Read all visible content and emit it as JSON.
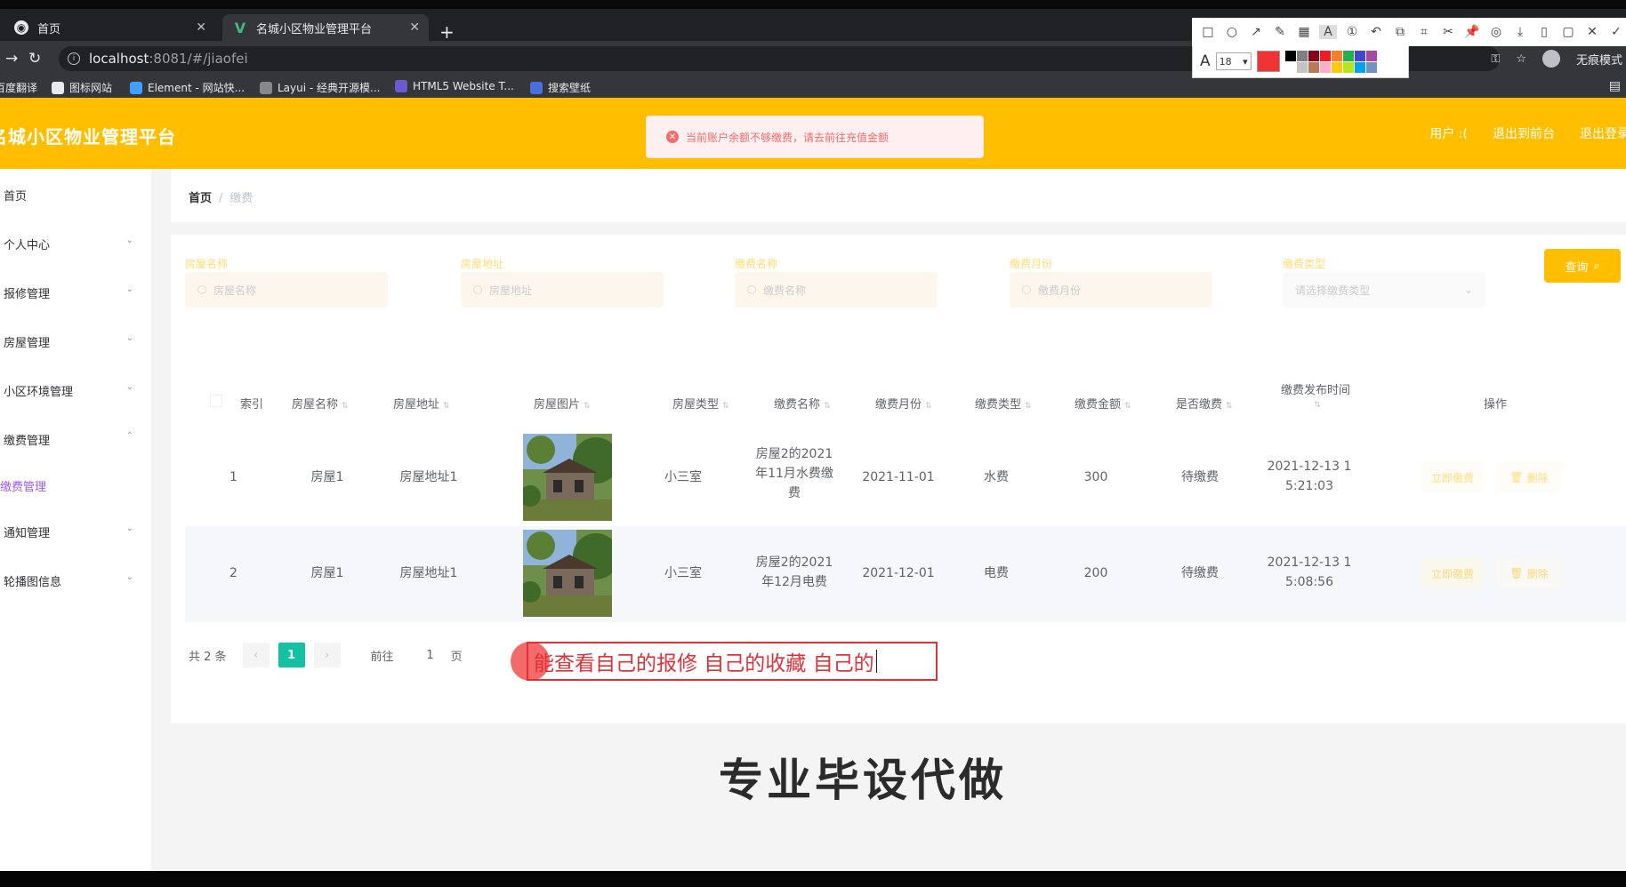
{
  "browser": {
    "tabs": [
      {
        "title": "首页",
        "favicon": "globe-icon"
      },
      {
        "title": "名城小区物业管理平台",
        "favicon": "vue-icon"
      }
    ],
    "url_host": "localhost",
    "url_port": ":8081",
    "url_path": "/#/jiaofei",
    "incognito_label": "无痕模式",
    "bookmarks": [
      "百度翻译",
      "图标网站",
      "Element - 网站快...",
      "Layui - 经典开源模...",
      "HTML5 Website T...",
      "搜索壁纸"
    ]
  },
  "snip_toolbar": {
    "font_size": "18",
    "current_color": "#f03434",
    "palette": [
      "#000000",
      "#7f7f7f",
      "#880015",
      "#ed1c24",
      "#ff7f27",
      "#22b14c",
      "#3f48cc",
      "#a349a4",
      "#ffffff",
      "#c3c3c3",
      "#b97a57",
      "#ffaec9",
      "#ffc90e",
      "#b5e61d",
      "#00a2e8",
      "#7092be"
    ]
  },
  "header": {
    "title": "名城小区物业管理平台",
    "alert": "当前账户余额不够缴费，请去前往充值金额",
    "user_label": "用户 :(",
    "back_label": "退出到前台",
    "logout_label": "退出登录",
    "brand_color": "#ffbe00"
  },
  "sidebar": {
    "items": [
      {
        "label": "首页"
      },
      {
        "label": "个人中心"
      },
      {
        "label": "报修管理"
      },
      {
        "label": "房屋管理"
      },
      {
        "label": "小区环境管理"
      },
      {
        "label": "缴费管理"
      },
      {
        "label": "缴费管理"
      },
      {
        "label": "通知管理"
      },
      {
        "label": "轮播图信息"
      }
    ]
  },
  "breadcrumb": {
    "home": "首页",
    "current": "缴费"
  },
  "search": {
    "fields": [
      {
        "label": "房屋名称",
        "placeholder": "房屋名称"
      },
      {
        "label": "房屋地址",
        "placeholder": "房屋地址"
      },
      {
        "label": "缴费名称",
        "placeholder": "缴费名称"
      },
      {
        "label": "缴费月份",
        "placeholder": "缴费月份"
      },
      {
        "label": "缴费类型",
        "placeholder": "请选择缴费类型"
      }
    ],
    "button_label": "查询"
  },
  "table": {
    "headers": [
      "索引",
      "房屋名称",
      "房屋地址",
      "房屋图片",
      "房屋类型",
      "缴费名称",
      "缴费月份",
      "缴费类型",
      "缴费金额",
      "是否缴费",
      "缴费发布时间",
      "操作"
    ],
    "rows": [
      {
        "index": "1",
        "name": "房屋1",
        "address": "房屋地址1",
        "type": "小三室",
        "fee_name_l1": "房屋2的2021",
        "fee_name_l2": "年11月水费缴",
        "fee_name_l3": "费",
        "month": "2021-11-01",
        "fee_type": "水费",
        "amount": "300",
        "paid": "待缴费",
        "time_l1": "2021-12-13 1",
        "time_l2": "5:21:03",
        "op1": "立即缴费",
        "op2": "删除"
      },
      {
        "index": "2",
        "name": "房屋1",
        "address": "房屋地址1",
        "type": "小三室",
        "fee_name_l1": "房屋2的2021",
        "fee_name_l2": "年12月电费",
        "fee_name_l3": "",
        "month": "2021-12-01",
        "fee_type": "电费",
        "amount": "200",
        "paid": "待缴费",
        "time_l1": "2021-12-13 1",
        "time_l2": "5:08:56",
        "op1": "立即缴费",
        "op2": "删除"
      }
    ]
  },
  "pager": {
    "total": "共 2 条",
    "current": "1",
    "goto": "前往",
    "goto_value": "1",
    "page_unit": "页"
  },
  "annotation": {
    "text": "能查看自己的报修 自己的收藏 自己的"
  },
  "overlay_text": "专业毕设代做"
}
